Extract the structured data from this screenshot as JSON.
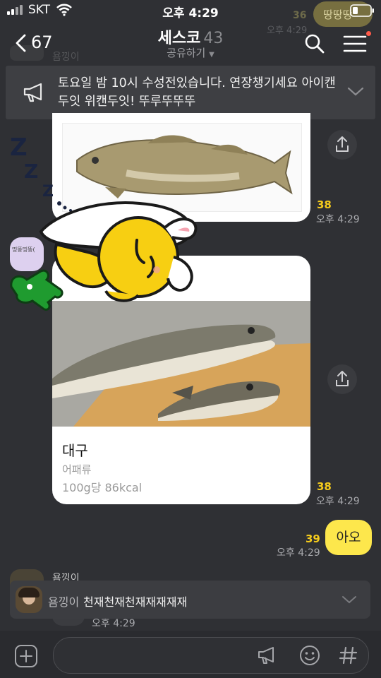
{
  "status": {
    "carrier": "SKT",
    "time": "오후 4:29"
  },
  "header": {
    "back_count": "67",
    "title": "세스코",
    "member_count": "43",
    "share_label": "공유하기"
  },
  "background_hints": {
    "top_right_chip": "땅땅땅",
    "top_right_count": "36",
    "top_right_time": "오후 4:29",
    "top_left_name": "욤낑이"
  },
  "notice": {
    "text": "토요일 밤 10시 수성전있습니다. 연장챙기세요 아이캔두잇 위캔두잇! 뚜루뚜뚜뚜"
  },
  "card1": {
    "count": "38",
    "time": "오후 4:29"
  },
  "sticker_user": {
    "avatar_text": "띵똥띵똥("
  },
  "card2": {
    "name": "대구",
    "category": "어패류",
    "nutrition": "100g당 86kcal",
    "count": "38",
    "time": "오후 4:29"
  },
  "my_message": {
    "text": "아오",
    "count": "39",
    "time": "오후 4:29"
  },
  "next_sender": {
    "name": "욤낑이",
    "time": "오후 4:29"
  },
  "preview": {
    "sender": "욤낑이",
    "message": "천재천재천재재재재재"
  },
  "colors": {
    "accent": "#fde74c",
    "unread": "#f5cb1c",
    "background": "#2f3034"
  }
}
